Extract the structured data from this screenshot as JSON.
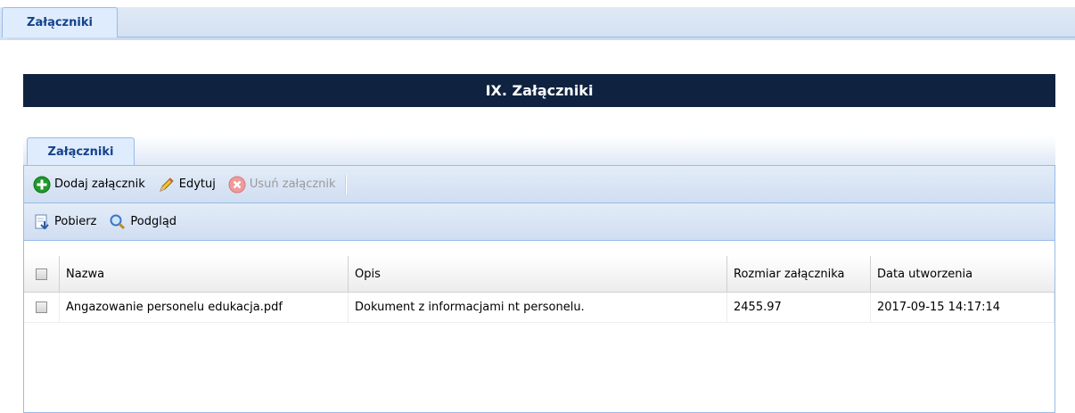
{
  "outer_tab": {
    "label": "Załączniki"
  },
  "section": {
    "title": "IX. Załączniki"
  },
  "inner_tab": {
    "label": "Załączniki"
  },
  "toolbar1": {
    "add_label": "Dodaj załącznik",
    "edit_label": "Edytuj",
    "delete_label": "Usuń załącznik"
  },
  "toolbar2": {
    "download_label": "Pobierz",
    "preview_label": "Podgląd"
  },
  "grid": {
    "columns": [
      "Nazwa",
      "Opis",
      "Rozmiar załącznika",
      "Data utworzenia"
    ],
    "rows": [
      [
        "Angazowanie personelu edukacja.pdf",
        "Dokument z informacjami nt personelu.",
        "2455.97",
        "2017-09-15 14:17:14"
      ]
    ]
  },
  "colors": {
    "header_bg": "#0f2240",
    "tab_text": "#15428b",
    "border": "#99bbe8"
  }
}
